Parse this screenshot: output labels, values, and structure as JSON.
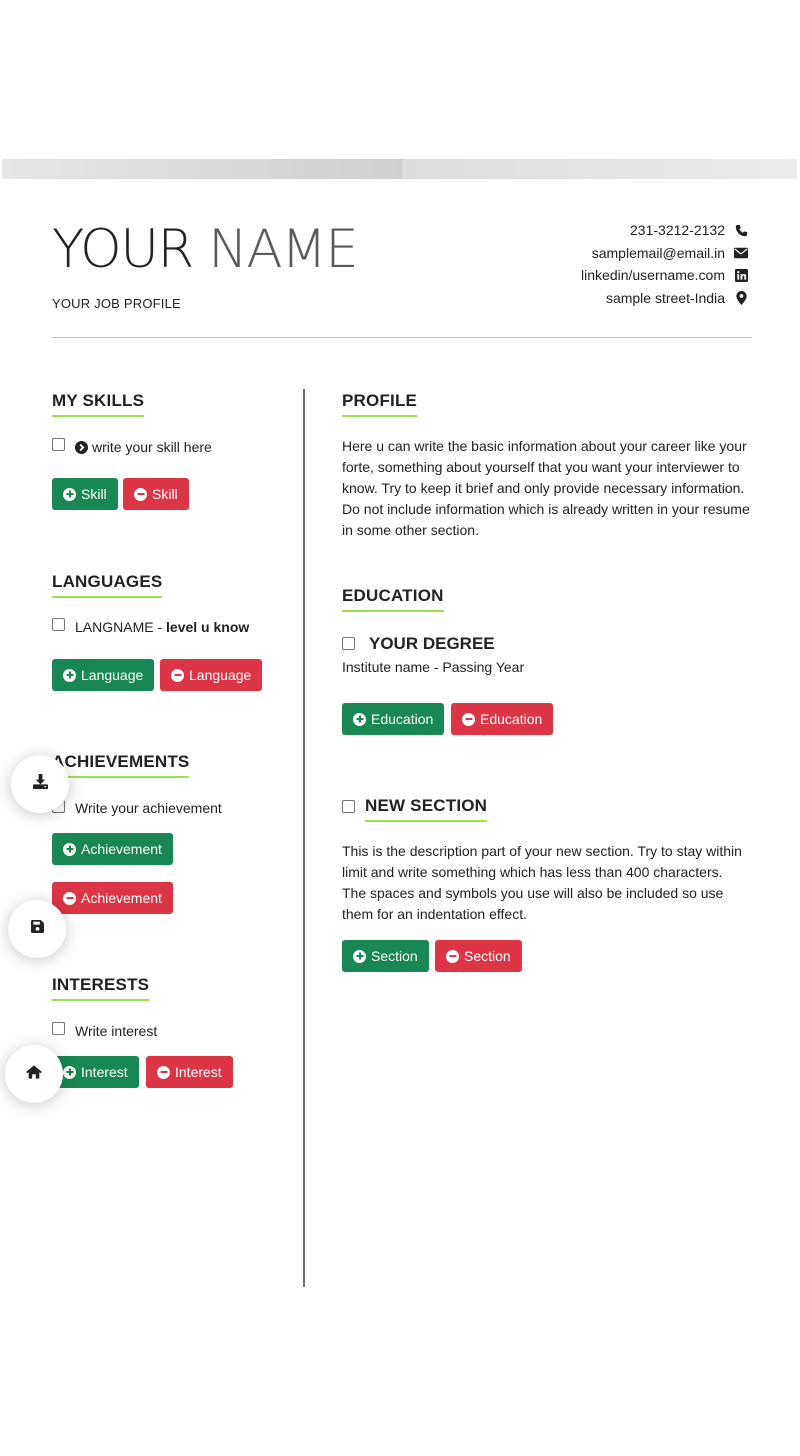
{
  "header": {
    "first_name": "YOUR",
    "last_name": "NAME",
    "job_profile": "YOUR JOB PROFILE",
    "contacts": [
      {
        "text": "231-3212-2132",
        "icon": "phone-icon"
      },
      {
        "text": "samplemail@email.in",
        "icon": "envelope-icon"
      },
      {
        "text": "linkedin/username.com",
        "icon": "linkedin-icon"
      },
      {
        "text": "sample street-India",
        "icon": "map-marker-icon"
      }
    ]
  },
  "left": {
    "skills": {
      "title": "MY SKILLS",
      "item": "write your skill here",
      "add_label": "Skill",
      "remove_label": "Skill"
    },
    "languages": {
      "title": "LANGUAGES",
      "item_name": "LANGNAME",
      "item_sep": " - ",
      "item_level": "level u know",
      "add_label": "Language",
      "remove_label": "Language"
    },
    "achievements": {
      "title": "ACHIEVEMENTS",
      "item": "Write your achievement",
      "add_label": "Achievement",
      "remove_label": "Achievement"
    },
    "interests": {
      "title": "INTERESTS",
      "item": "Write interest",
      "add_label": "Interest",
      "remove_label": "Interest"
    }
  },
  "right": {
    "profile": {
      "title": "PROFILE",
      "text": "Here u can write the basic information about your career like your forte, something about yourself that you want your interviewer to know. Try to keep it brief and only provide necessary information. Do not include information which is already written in your resume in some other section."
    },
    "education": {
      "title": "EDUCATION",
      "degree": "YOUR DEGREE",
      "institute": "Institute name - Passing Year",
      "add_label": "Education",
      "remove_label": "Education"
    },
    "new_section": {
      "title": "NEW SECTION",
      "text": "This is the description part of your new section. Try to stay within limit and write something which has less than 400 characters. The spaces and symbols you use will also be included so use them for an indentation effect.",
      "add_label": "Section",
      "remove_label": "Section"
    }
  },
  "fabs": [
    {
      "icon": "download-icon"
    },
    {
      "icon": "save-icon"
    },
    {
      "icon": "home-icon"
    }
  ],
  "colors": {
    "add": "#198754",
    "remove": "#dc3545",
    "underline": "#9be34a"
  }
}
